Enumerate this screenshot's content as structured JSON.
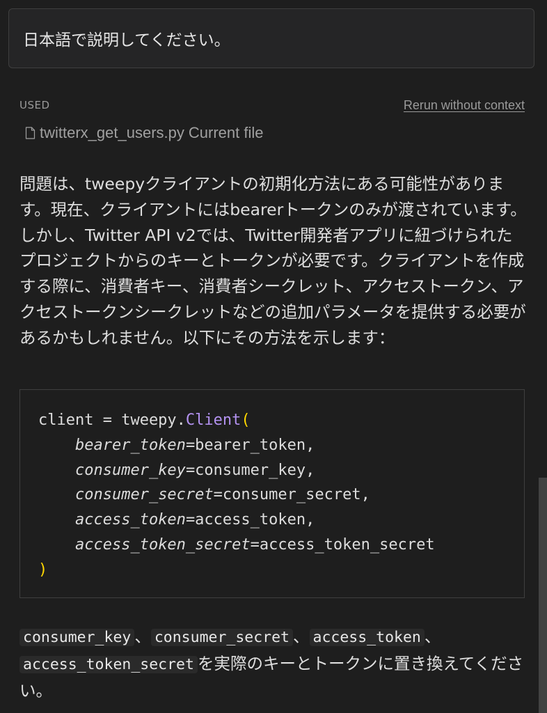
{
  "prompt": {
    "text": "日本語で説明してください。"
  },
  "context": {
    "used_label": "USED",
    "rerun_label": "Rerun without context",
    "file_name": "twitterx_get_users.py",
    "file_tag": "Current file",
    "file_icon": "file-icon"
  },
  "answer": {
    "paragraph": "問題は、tweepyクライアントの初期化方法にある可能性があります。現在、クライアントにはbearerトークンのみが渡されています。しかし、Twitter API v2では、Twitter開発者アプリに紐づけられたプロジェクトからのキーとトークンが必要です。クライアントを作成する際に、消費者キー、消費者シークレット、アクセストークン、アクセストークンシークレットなどの追加パラメータを提供する必要があるかもしれません。以下にその方法を示します："
  },
  "code": {
    "line1_prefix": "client = tweepy.",
    "line1_class": "Client",
    "open_paren": "(",
    "close_paren": ")",
    "args": [
      {
        "name": "bearer_token",
        "value": "=bearer_token,"
      },
      {
        "name": "consumer_key",
        "value": "=consumer_key,"
      },
      {
        "name": "consumer_secret",
        "value": "=consumer_secret,"
      },
      {
        "name": "access_token",
        "value": "=access_token,"
      },
      {
        "name": "access_token_secret",
        "value": "=access_token_secret"
      }
    ]
  },
  "footer": {
    "code1": "consumer_key",
    "sep1": "、",
    "code2": "consumer_secret",
    "sep2": "、",
    "code3": "access_token",
    "sep3": "、",
    "code4": "access_token_secret",
    "tail": "を実際のキーとトークンに置き換えてください。"
  },
  "colors": {
    "background": "#1e1e1e",
    "class_name": "#b392f0",
    "paren": "#ffd700",
    "border": "#3f3f3f"
  }
}
